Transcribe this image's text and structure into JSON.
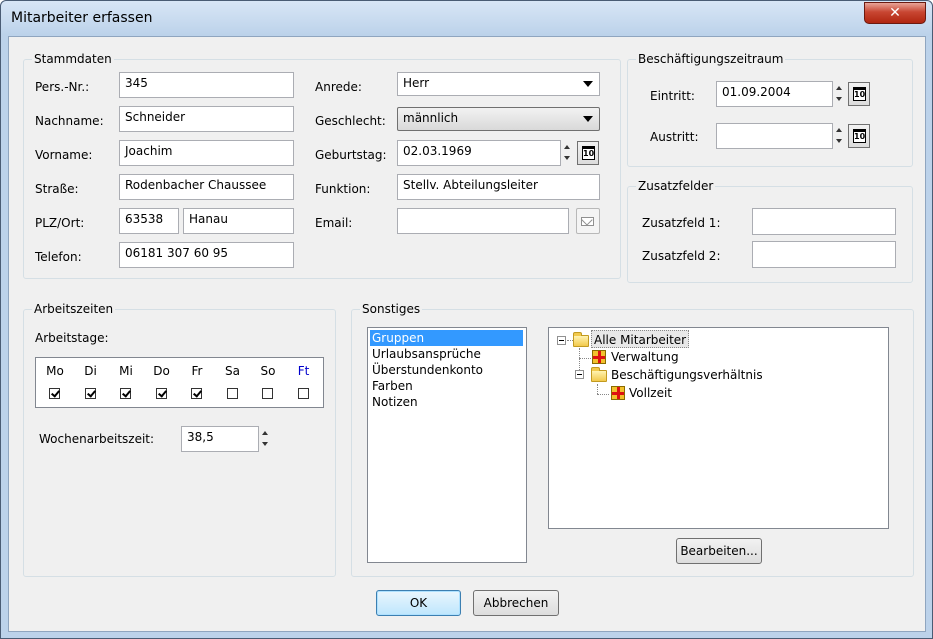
{
  "window": {
    "title": "Mitarbeiter erfassen",
    "close_glyph": "✕"
  },
  "stammdaten": {
    "title": "Stammdaten",
    "persnr": {
      "label": "Pers.-Nr.:",
      "value": "345"
    },
    "nachname": {
      "label": "Nachname:",
      "value": "Schneider"
    },
    "vorname": {
      "label": "Vorname:",
      "value": "Joachim"
    },
    "strasse": {
      "label": "Straße:",
      "value": "Rodenbacher Chaussee"
    },
    "plzort": {
      "label": "PLZ/Ort:",
      "plz": "63538",
      "ort": "Hanau"
    },
    "telefon": {
      "label": "Telefon:",
      "value": "06181 307 60 95"
    },
    "anrede": {
      "label": "Anrede:",
      "value": "Herr"
    },
    "geschlecht": {
      "label": "Geschlecht:",
      "value": "männlich"
    },
    "geburtstag": {
      "label": "Geburtstag:",
      "value": "02.03.1969"
    },
    "funktion": {
      "label": "Funktion:",
      "value": "Stellv. Abteilungsleiter"
    },
    "email": {
      "label": "Email:",
      "value": ""
    }
  },
  "beschaeftigung": {
    "title": "Beschäftigungszeitraum",
    "eintritt": {
      "label": "Eintritt:",
      "value": "01.09.2004"
    },
    "austritt": {
      "label": "Austritt:",
      "value": ""
    }
  },
  "zusatzfelder": {
    "title": "Zusatzfelder",
    "feld1": {
      "label": "Zusatzfeld 1:",
      "value": ""
    },
    "feld2": {
      "label": "Zusatzfeld 2:",
      "value": ""
    }
  },
  "arbeitszeiten": {
    "title": "Arbeitszeiten",
    "arbeitstage_label": "Arbeitstage:",
    "days": [
      {
        "name": "Mo",
        "checked": true
      },
      {
        "name": "Di",
        "checked": true
      },
      {
        "name": "Mi",
        "checked": true
      },
      {
        "name": "Do",
        "checked": true
      },
      {
        "name": "Fr",
        "checked": true
      },
      {
        "name": "Sa",
        "checked": false
      },
      {
        "name": "So",
        "checked": false
      },
      {
        "name": "Ft",
        "checked": false
      }
    ],
    "holiday_color": "#0000cc",
    "wochenarbeitszeit": {
      "label": "Wochenarbeitszeit:",
      "value": "38,5"
    }
  },
  "sonstiges": {
    "title": "Sonstiges",
    "list": [
      "Gruppen",
      "Urlaubsansprüche",
      "Überstundenkonto",
      "Farben",
      "Notizen"
    ],
    "selected_index": 0,
    "tree": {
      "root": "Alle Mitarbeiter",
      "child1": "Verwaltung",
      "child2": "Beschäftigungsverhältnis",
      "grandchild": "Vollzeit"
    },
    "edit_button": "Bearbeiten..."
  },
  "footer": {
    "ok": "OK",
    "cancel": "Abbrechen"
  },
  "colors": {
    "selection": "#3399ff",
    "titlebar": "#bcd2ea",
    "close": "#c84632"
  },
  "icons": {
    "calendar": "calendar-icon",
    "mail": "envelope-icon",
    "folder": "folder-icon",
    "group": "gift-group-icon"
  },
  "calendar_icon_text": "10"
}
